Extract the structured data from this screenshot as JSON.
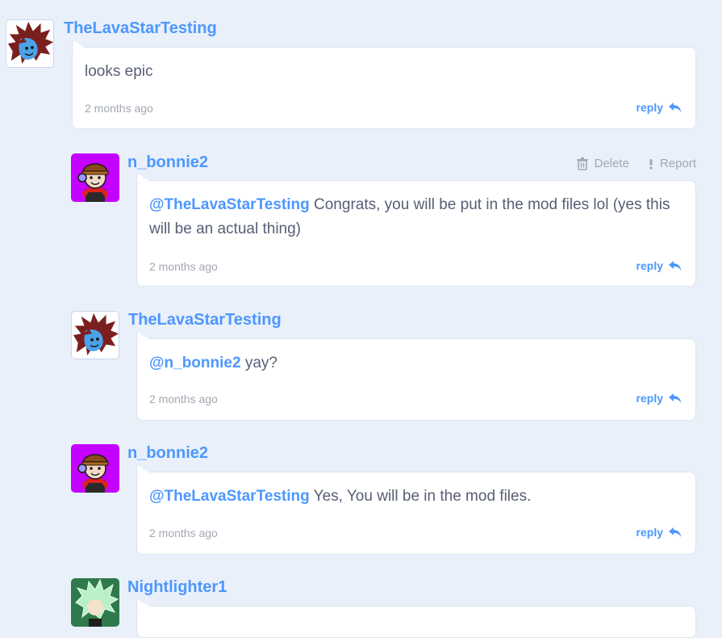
{
  "comments": [
    {
      "username": "TheLavaStarTesting",
      "avatar": "lava-star-avatar",
      "mention": "",
      "text": "looks epic",
      "time": "2 months ago",
      "reply_label": "reply"
    },
    {
      "username": "n_bonnie2",
      "avatar": "bonnie-avatar",
      "mention": "@TheLavaStarTesting",
      "text": "Congrats, you will be put in the mod files lol (yes this will be an actual thing)",
      "time": "2 months ago",
      "reply_label": "reply",
      "delete_label": "Delete",
      "report_label": "Report"
    },
    {
      "username": "TheLavaStarTesting",
      "avatar": "lava-star-avatar",
      "mention": "@n_bonnie2",
      "text": "yay?",
      "time": "2 months ago",
      "reply_label": "reply"
    },
    {
      "username": "n_bonnie2",
      "avatar": "bonnie-avatar",
      "mention": "@TheLavaStarTesting",
      "text": "Yes, You will be in the mod files.",
      "time": "2 months ago",
      "reply_label": "reply"
    },
    {
      "username": "Nightlighter1",
      "avatar": "nightlighter-avatar"
    }
  ],
  "icons": {
    "reply": "reply-arrow-icon",
    "delete": "trash-icon",
    "report": "exclamation-icon"
  },
  "colors": {
    "background": "#e9f0f9",
    "link": "#4d97ff",
    "text": "#575e75",
    "muted": "#a2a7b3",
    "bonnie_avatar_bg": "#c400ff",
    "nightlighter_avatar_bg": "#2f7a4a"
  }
}
